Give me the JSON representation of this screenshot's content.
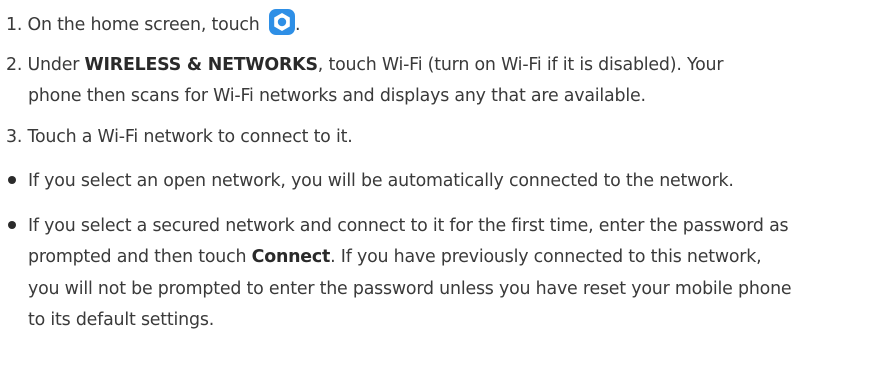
{
  "steps": [
    {
      "number": "1.",
      "text_before_icon": "On the home screen, touch",
      "icon": "settings-icon",
      "text_after_icon": "."
    },
    {
      "number": "2.",
      "text_a": "Under",
      "bold": "WIRELESS & NETWORKS",
      "text_b": ", touch Wi-Fi (turn on Wi-Fi if it is disabled). Your",
      "text_c": "phone then scans for Wi-Fi networks and displays any that are available."
    },
    {
      "number": "3.",
      "text": "Touch a Wi-Fi network to connect to it."
    }
  ],
  "bullets": [
    {
      "text": "If you select an open network, you will be automatically connected to the network."
    },
    {
      "line1": "If you select a secured network and connect to it for the first time, enter the password as",
      "line2_a": "prompted and then touch",
      "line2_bold": "Connect",
      "line2_b": ". If you have previously connected to this network,",
      "line3": "you will not be prompted to enter the password unless you have reset your mobile phone",
      "line4": "to its default settings."
    }
  ],
  "colors": {
    "icon_blue": "#2e8fe6",
    "text": "#3a3a3a"
  }
}
